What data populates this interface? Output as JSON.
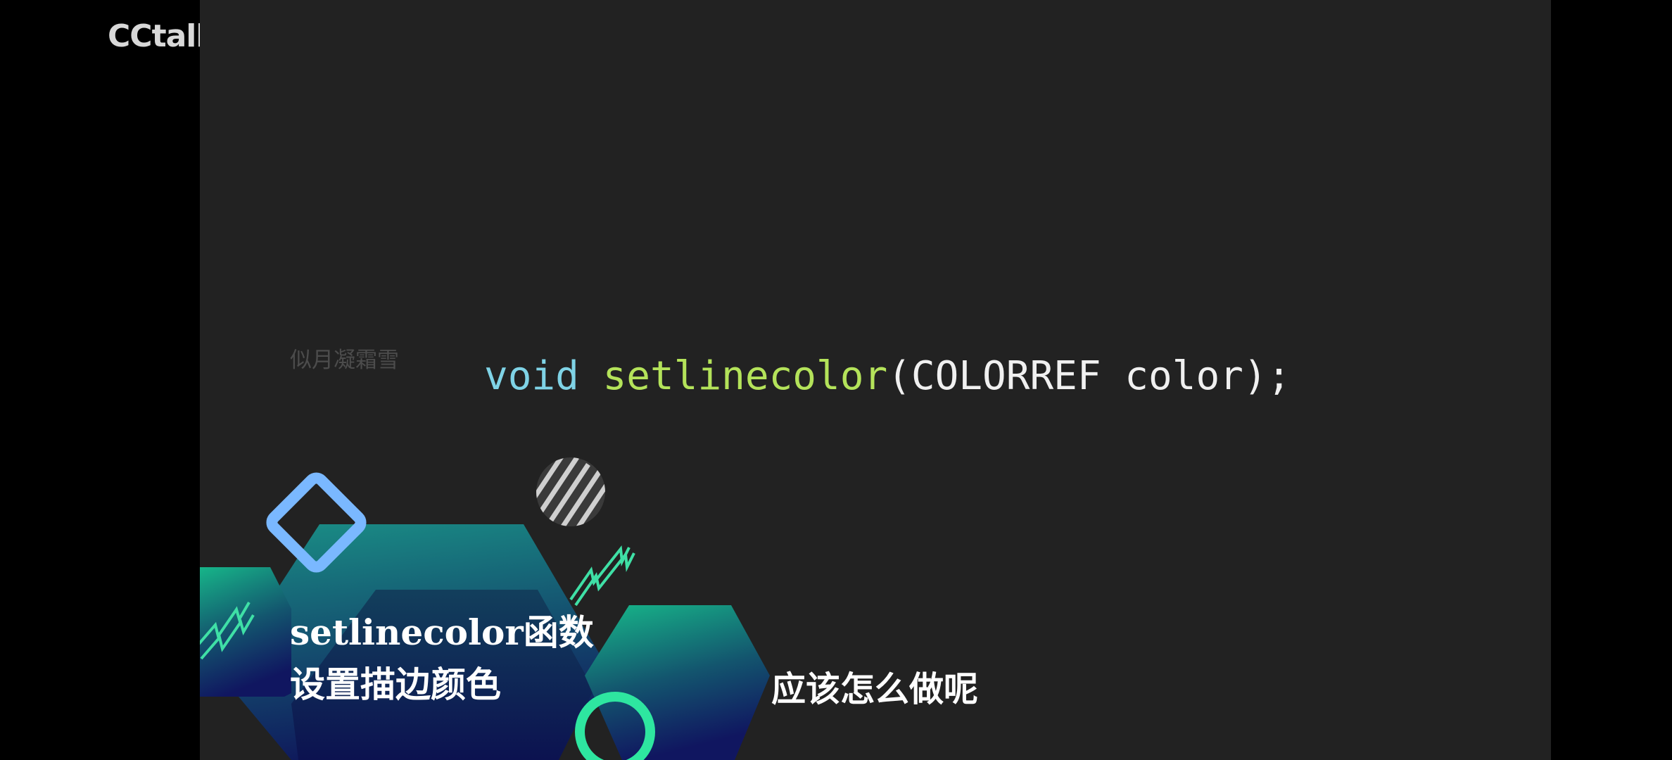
{
  "brand": {
    "logo_text": "CCtalk"
  },
  "video": {
    "watermark": "似月凝霜雪",
    "code": {
      "keyword": "void",
      "function_name": "setlinecolor",
      "params": "(COLORREF color);"
    },
    "caption": {
      "line1": "setlinecolor函数",
      "line2": "设置描边颜色"
    },
    "subtitle": "应该怎么做呢"
  },
  "colors": {
    "keyword": "#7fd3e6",
    "function": "#b4e35a",
    "background": "#222222",
    "accent_green": "#2ee6a0",
    "accent_blue": "#7ab8ff"
  }
}
